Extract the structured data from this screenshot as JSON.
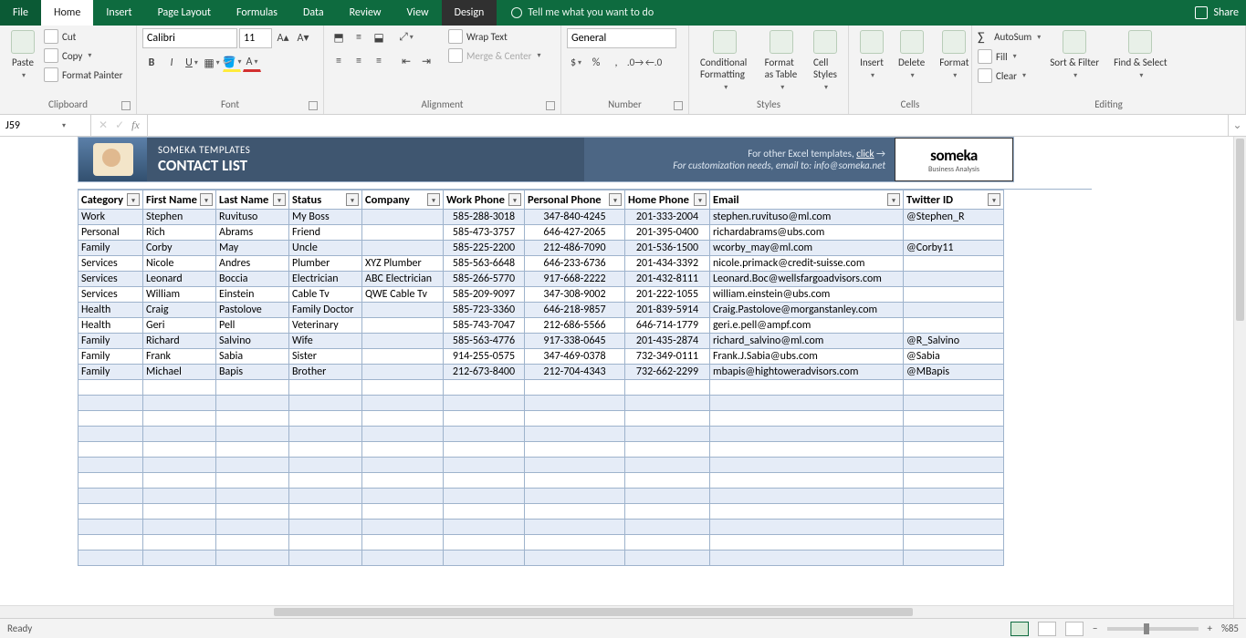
{
  "tabs": [
    "File",
    "Home",
    "Insert",
    "Page Layout",
    "Formulas",
    "Data",
    "Review",
    "View",
    "Design"
  ],
  "activeTab": "Home",
  "tellme": "Tell me what you want to do",
  "share": "Share",
  "clipboard": {
    "paste": "Paste",
    "cut": "Cut",
    "copy": "Copy",
    "fmtpaint": "Format Painter",
    "label": "Clipboard"
  },
  "font": {
    "name": "Calibri",
    "size": "11",
    "label": "Font"
  },
  "alignment": {
    "wrap": "Wrap Text",
    "merge": "Merge & Center",
    "label": "Alignment"
  },
  "number": {
    "format": "General",
    "label": "Number"
  },
  "styles": {
    "cond": "Conditional Formatting",
    "astable": "Format as Table",
    "cellstyles": "Cell Styles",
    "label": "Styles"
  },
  "cells": {
    "insert": "Insert",
    "delete": "Delete",
    "format": "Format",
    "label": "Cells"
  },
  "editing": {
    "autosum": "AutoSum",
    "fill": "Fill",
    "clear": "Clear",
    "sort": "Sort & Filter",
    "find": "Find & Select",
    "label": "Editing"
  },
  "namebox": "J59",
  "formula": "",
  "banner": {
    "brand": "SOMEKA TEMPLATES",
    "title": "CONTACT LIST",
    "line1_pre": "For other Excel templates, ",
    "line1_link": "click",
    "line2": "For customization needs, email to: info@someka.net",
    "logo": "someka",
    "logosub": "Business Analysis"
  },
  "headers": [
    "Category",
    "First Name",
    "Last Name",
    "Status",
    "Company",
    "Work Phone",
    "Personal Phone",
    "Home Phone",
    "Email",
    "Twitter ID"
  ],
  "rows": [
    [
      "Work",
      "Stephen",
      "Ruvituso",
      "My Boss",
      "",
      "585-288-3018",
      "347-840-4245",
      "201-333-2004",
      "stephen.ruvituso@ml.com",
      "@Stephen_R"
    ],
    [
      "Personal",
      "Rich",
      "Abrams",
      "Friend",
      "",
      "585-473-3757",
      "646-427-2065",
      "201-395-0400",
      "richardabrams@ubs.com",
      ""
    ],
    [
      "Family",
      "Corby",
      "May",
      "Uncle",
      "",
      "585-225-2200",
      "212-486-7090",
      "201-536-1500",
      "wcorby_may@ml.com",
      "@Corby11"
    ],
    [
      "Services",
      "Nicole",
      "Andres",
      "Plumber",
      "XYZ Plumber",
      "585-563-6648",
      "646-233-6736",
      "201-434-3392",
      "nicole.primack@credit-suisse.com",
      ""
    ],
    [
      "Services",
      "Leonard",
      "Boccia",
      "Electrician",
      "ABC Electrician",
      "585-266-5770",
      "917-668-2222",
      "201-432-8111",
      "Leonard.Boc@wellsfargoadvisors.com",
      ""
    ],
    [
      "Services",
      "William",
      "Einstein",
      "Cable Tv",
      "QWE Cable Tv",
      "585-209-9097",
      "347-308-9002",
      "201-222-1055",
      "william.einstein@ubs.com",
      ""
    ],
    [
      "Health",
      "Craig",
      "Pastolove",
      "Family Doctor",
      "",
      "585-723-3360",
      "646-218-9857",
      "201-839-5914",
      "Craig.Pastolove@morganstanley.com",
      ""
    ],
    [
      "Health",
      "Geri",
      "Pell",
      "Veterinary",
      "",
      "585-743-7047",
      "212-686-5566",
      "646-714-1779",
      "geri.e.pell@ampf.com",
      ""
    ],
    [
      "Family",
      "Richard",
      "Salvino",
      "Wife",
      "",
      "585-563-4776",
      "917-338-0645",
      "201-435-2874",
      "richard_salvino@ml.com",
      "@R_Salvino"
    ],
    [
      "Family",
      "Frank",
      "Sabia",
      "Sister",
      "",
      "914-255-0575",
      "347-469-0378",
      "732-349-0111",
      "Frank.J.Sabia@ubs.com",
      "@Sabia"
    ],
    [
      "Family",
      "Michael",
      "Bapis",
      "Brother",
      "",
      "212-673-8400",
      "212-704-4343",
      "732-662-2299",
      "mbapis@hightoweradvisors.com",
      "@MBapis"
    ]
  ],
  "emptyRows": 12,
  "status": {
    "ready": "Ready",
    "zoom": "%85"
  }
}
